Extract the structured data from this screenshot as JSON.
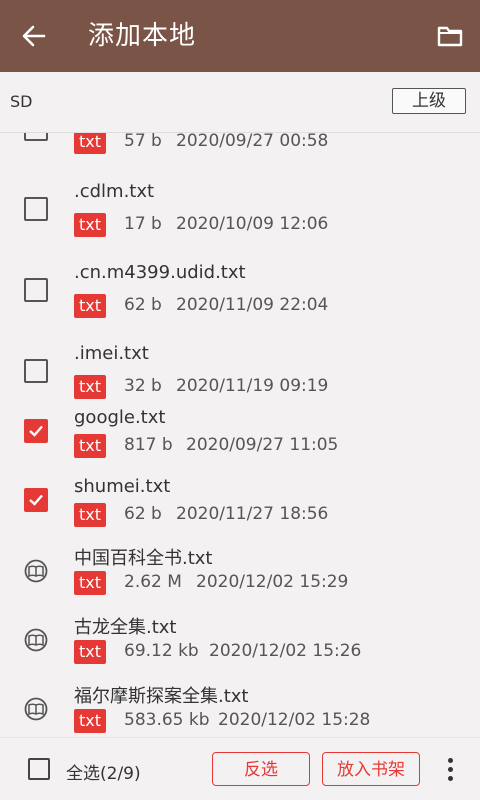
{
  "appbar": {
    "title": "添加本地"
  },
  "pathbar": {
    "path": "SD",
    "up_label": "上级"
  },
  "files": [
    {
      "name": "",
      "type": "txt",
      "size": "57 b",
      "date": "2020/09/27 00:58",
      "state": "unchecked"
    },
    {
      "name": ".cdlm.txt",
      "type": "txt",
      "size": "17 b",
      "date": "2020/10/09 12:06",
      "state": "unchecked"
    },
    {
      "name": ".cn.m4399.udid.txt",
      "type": "txt",
      "size": "62 b",
      "date": "2020/11/09 22:04",
      "state": "unchecked"
    },
    {
      "name": ".imei.txt",
      "type": "txt",
      "size": "32 b",
      "date": "2020/11/19 09:19",
      "state": "unchecked"
    },
    {
      "name": "google.txt",
      "type": "txt",
      "size": "817 b",
      "date": "2020/09/27 11:05",
      "state": "checked"
    },
    {
      "name": "shumei.txt",
      "type": "txt",
      "size": "62 b",
      "date": "2020/11/27 18:56",
      "state": "checked"
    },
    {
      "name": "中国百科全书.txt",
      "type": "txt",
      "size": "2.62 M",
      "date": "2020/12/02 15:29",
      "state": "in-shelf"
    },
    {
      "name": "古龙全集.txt",
      "type": "txt",
      "size": "69.12 kb",
      "date": "2020/12/02 15:26",
      "state": "in-shelf"
    },
    {
      "name": "福尔摩斯探案全集.txt",
      "type": "txt",
      "size": "583.65 kb",
      "date": "2020/12/02 15:28",
      "state": "in-shelf"
    }
  ],
  "bottombar": {
    "select_all_label": "全选(2/9)",
    "invert_label": "反选",
    "add_label": "放入书架"
  },
  "colors": {
    "appbar": "#7a5447",
    "accent": "#e53935",
    "background": "#f4f1f3"
  }
}
